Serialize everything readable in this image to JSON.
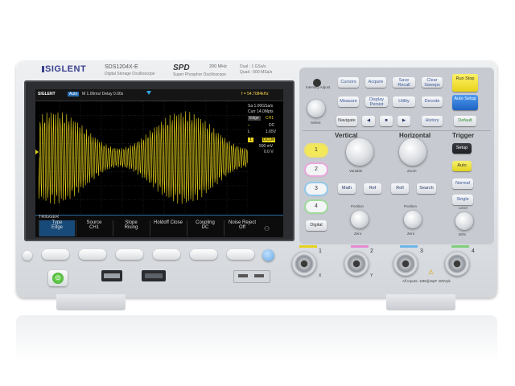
{
  "device": {
    "brand": "SIGLENT",
    "model": "SDS1204X-E",
    "model_sub": "Digital Storage Oscilloscope",
    "logo_mark": "SPD",
    "logo_sub": "Super Phosphor Oscilloscope",
    "bandwidth": "200 MHz",
    "sample_rate": "Dual : 1 GSa/s",
    "memory": "Quad : 500 MSa/s"
  },
  "screen": {
    "brand": "SIGLENT",
    "mode": "Auto",
    "timebase": "M 1.00ms/ Delay 0.00s",
    "frequency": "f = 54.7084kHz",
    "sa_rate": "Sa 1.00GSa/s",
    "curr": "Curr 14.0Mpts",
    "trig_type": "Edge",
    "trig_src": "CH1",
    "coupling": "DC",
    "trig_level": "1.65V",
    "ch1_label": "1",
    "ch1_coup": "DC1M",
    "ch1_scale": "500 mV",
    "ch1_offset": "0.0 V",
    "trace_color": "#e6d21c"
  },
  "trigger_menu": {
    "title": "TRIGGER",
    "items": [
      {
        "l1": "Type",
        "l2": "Edge"
      },
      {
        "l1": "Source",
        "l2": "CH1"
      },
      {
        "l1": "Slope",
        "l2": "Rising"
      },
      {
        "l1": "Holdoff Close",
        "l2": ""
      },
      {
        "l1": "Coupling",
        "l2": "DC"
      },
      {
        "l1": "Noise Reject",
        "l2": "Off"
      }
    ]
  },
  "panel": {
    "intensity": "Intensity Adjust",
    "push_select": "Select",
    "top_buttons": [
      "Cursors",
      "Acquire",
      "Save Recall",
      "Clear Sweeps",
      "Measure",
      "Display Persist",
      "Utility",
      "Decode"
    ],
    "run_stop": "Run Stop",
    "auto_setup": "Auto Setup",
    "default": "Default",
    "navigate": "Navigate",
    "history": "History",
    "vertical_title": "Vertical",
    "horizontal_title": "Horizontal",
    "trigger_title": "Trigger",
    "variable": "Variable",
    "zoom": "Zoom",
    "channels": [
      "1",
      "2",
      "3",
      "4"
    ],
    "digital": "Digital",
    "math": "Math",
    "ref": "Ref",
    "roll": "Roll",
    "search": "Search",
    "position": "Position",
    "zero": "Zero",
    "setup": "Setup",
    "auto": "Auto",
    "normal": "Normal",
    "single": "Single",
    "level": "Level",
    "fifty": "50%",
    "ch_colors": [
      "#e6d21c",
      "#e38ad0",
      "#6fb7e8",
      "#7ecf7a"
    ]
  },
  "connectors": {
    "labels": [
      "1",
      "2",
      "3",
      "4"
    ],
    "xy": [
      "X",
      "Y"
    ],
    "input_note": "All Inputs: 1MΩ||15pF 400Vpk"
  }
}
